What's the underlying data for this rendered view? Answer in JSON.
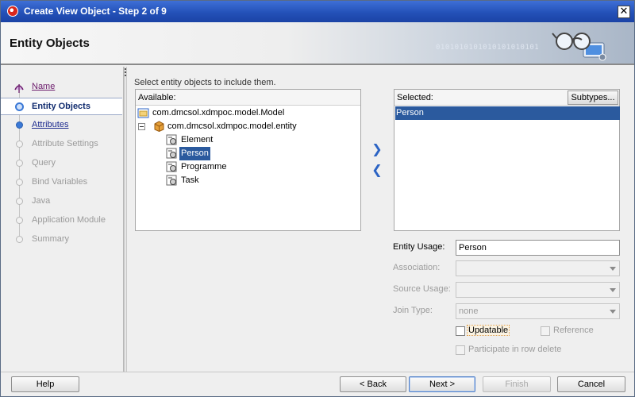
{
  "window": {
    "title": "Create View Object - Step 2 of 9",
    "close_glyph": "✕"
  },
  "header": {
    "title": "Entity Objects",
    "binary_text": "0101010101010101010101"
  },
  "nav": {
    "items": [
      {
        "label": "Name",
        "state": "visited"
      },
      {
        "label": "Entity Objects",
        "state": "current"
      },
      {
        "label": "Attributes",
        "state": "link"
      },
      {
        "label": "Attribute Settings",
        "state": "disabled"
      },
      {
        "label": "Query",
        "state": "disabled"
      },
      {
        "label": "Bind Variables",
        "state": "disabled"
      },
      {
        "label": "Java",
        "state": "disabled"
      },
      {
        "label": "Application Module",
        "state": "disabled"
      },
      {
        "label": "Summary",
        "state": "disabled"
      }
    ]
  },
  "main": {
    "instruction": "Select entity objects to include them.",
    "available": {
      "header": "Available:",
      "tree": [
        {
          "label": "com.dmcsol.xdmpoc.model.Model",
          "icon": "package-folder-icon",
          "level": 0
        },
        {
          "label": "com.dmcsol.xdmpoc.model.entity",
          "icon": "package-icon",
          "level": 0,
          "expanded": true
        },
        {
          "label": "Element",
          "icon": "entity-icon",
          "level": 1
        },
        {
          "label": "Person",
          "icon": "entity-icon",
          "level": 1,
          "selected": true
        },
        {
          "label": "Programme",
          "icon": "entity-icon",
          "level": 1
        },
        {
          "label": "Task",
          "icon": "entity-icon",
          "level": 1
        }
      ]
    },
    "move_right_glyph": "❯",
    "move_left_glyph": "❮",
    "selected": {
      "header": "Selected:",
      "subtypes_label": "Subtypes...",
      "items": [
        "Person"
      ]
    },
    "form": {
      "entity_usage_label": "Entity Usage:",
      "entity_usage_value": "Person",
      "association_label": "Association:",
      "association_value": "",
      "source_usage_label": "Source Usage:",
      "source_usage_value": "",
      "join_type_label": "Join Type:",
      "join_type_value": "none",
      "updatable_label": "Updatable",
      "reference_label": "Reference",
      "participate_label": "Participate in row delete"
    }
  },
  "footer": {
    "help": "Help",
    "back": "< Back",
    "next": "Next >",
    "finish": "Finish",
    "cancel": "Cancel"
  },
  "colors": {
    "title_bar": "#2451b8",
    "selection": "#2b5a9e",
    "link": "#1b2a8e",
    "visited_link": "#6b1a6b"
  }
}
